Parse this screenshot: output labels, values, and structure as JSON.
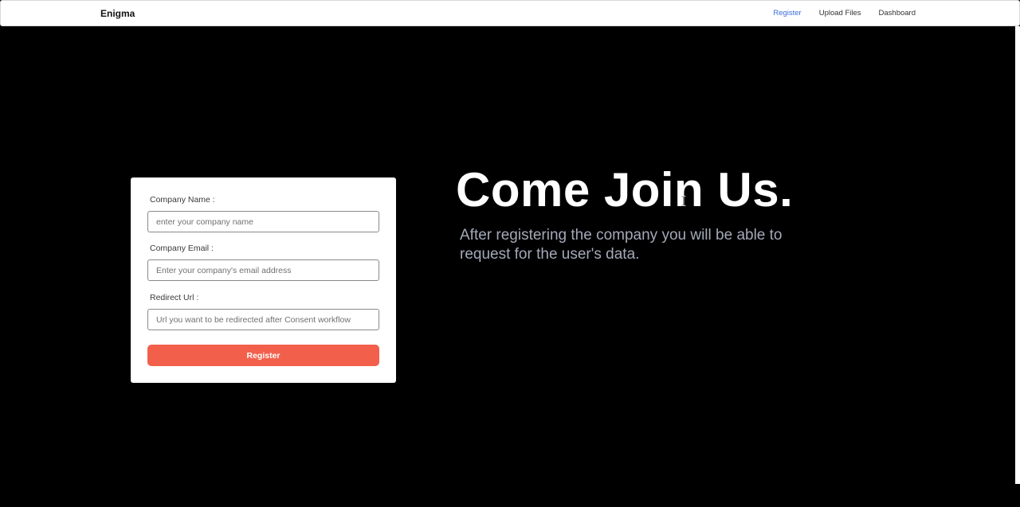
{
  "navbar": {
    "brand": "Enigma",
    "links": [
      {
        "label": "Register",
        "active": true
      },
      {
        "label": "Upload Files",
        "active": false
      },
      {
        "label": "Dashboard",
        "active": false
      }
    ]
  },
  "form": {
    "company_name": {
      "label": "Company Name :",
      "placeholder": "enter your company name",
      "value": ""
    },
    "company_email": {
      "label": "Company Email :",
      "placeholder": "Enter your company's email address",
      "value": ""
    },
    "redirect_url": {
      "label": "Redirect Url :",
      "placeholder": "Url you want to be redirected after Consent workflow",
      "value": ""
    },
    "submit_label": "Register"
  },
  "hero": {
    "title": "Come Join Us.",
    "subtitle": "After registering the company you will be able to request for the user's data."
  },
  "colors": {
    "background": "#000000",
    "accent": "#f2604c",
    "active_link": "#3b6fd8",
    "subtitle": "#a3a9b8"
  },
  "icons": {
    "cursor": "text-cursor-icon"
  }
}
